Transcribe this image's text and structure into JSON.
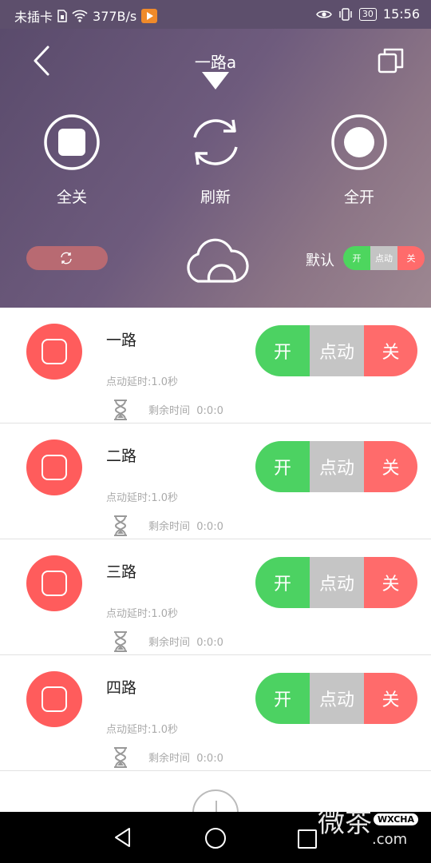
{
  "status_bar": {
    "carrier": "未插卡",
    "speed": "377B/s",
    "battery": "30",
    "time": "15:56"
  },
  "header": {
    "title": "一路a",
    "actions": [
      {
        "label": "全关",
        "icon": "stop-icon"
      },
      {
        "label": "刷新",
        "icon": "refresh-icon"
      },
      {
        "label": "全开",
        "icon": "record-icon"
      }
    ],
    "default_label": "默认",
    "mini_switch": {
      "on": "开",
      "dot": "点动",
      "off": "关"
    }
  },
  "colors": {
    "on": "#4cd262",
    "dot": "#c5c5c5",
    "off": "#ff6b6b",
    "icon_red": "#ff5c5c"
  },
  "channels": [
    {
      "name": "一路",
      "delay": "点动延时:1.0秒",
      "remaining_label": "剩余时间",
      "remaining": "0:0:0",
      "on": "开",
      "dot": "点动",
      "off": "关"
    },
    {
      "name": "二路",
      "delay": "点动延时:1.0秒",
      "remaining_label": "剩余时间",
      "remaining": "0:0:0",
      "on": "开",
      "dot": "点动",
      "off": "关"
    },
    {
      "name": "三路",
      "delay": "点动延时:1.0秒",
      "remaining_label": "剩余时间",
      "remaining": "0:0:0",
      "on": "开",
      "dot": "点动",
      "off": "关"
    },
    {
      "name": "四路",
      "delay": "点动延时:1.0秒",
      "remaining_label": "剩余时间",
      "remaining": "0:0:0",
      "on": "开",
      "dot": "点动",
      "off": "关"
    }
  ],
  "watermark": {
    "main": "微茶",
    "badge": "WXCHA",
    "sub": ".com"
  }
}
